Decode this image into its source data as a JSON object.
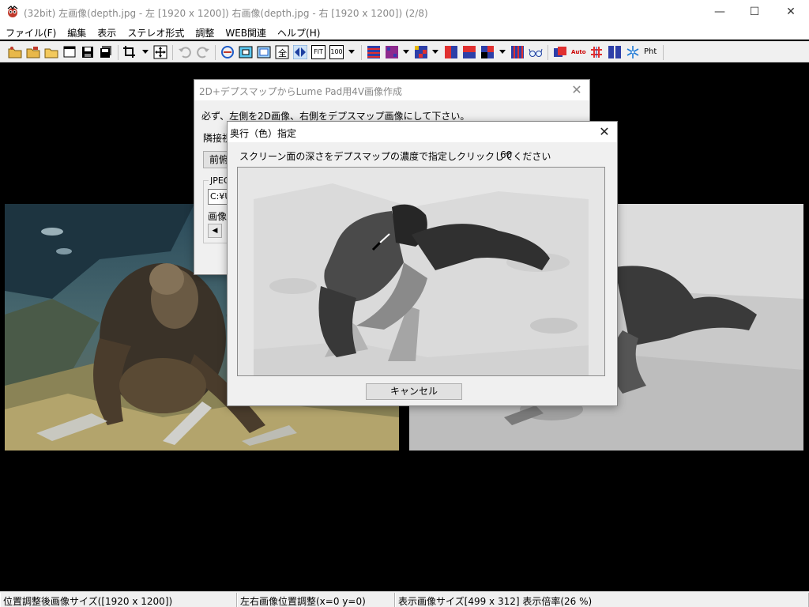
{
  "window": {
    "title": "(32bit) 左画像(depth.jpg - 左 [1920 x 1200]) 右画像(depth.jpg - 右 [1920 x 1200])  (2/8)",
    "minimize_label": "—",
    "maximize_label": "☐",
    "close_label": "✕"
  },
  "menu": [
    "ファイル(F)",
    "編集",
    "表示",
    "ステレオ形式",
    "調整",
    "WEB関連",
    "ヘルプ(H)"
  ],
  "toolbar": {
    "fit_label": "FIT",
    "zoom100_label": "100",
    "pht_label": "Pht",
    "auto_label": "Auto"
  },
  "back_dialog": {
    "title": "2D+デプスマップからLume Pad用4V画像作成",
    "close_label": "✕",
    "instruction": "必ず、左側を2D画像、右側をデプスマップ画像にして下さい。",
    "partial_label_1": "隣接視",
    "partial_button": "前俯",
    "group_label": "JPEG",
    "path_value": "C:¥U",
    "partial_label_2": "画像"
  },
  "front_dialog": {
    "title": "奥行（色）指定",
    "close_label": "✕",
    "prompt": "スクリーン面の深さをデプスマップの濃度で指定しクリックしてください",
    "depth_value": "60",
    "cancel_label": "キャンセル"
  },
  "statusbar": {
    "cell1": "位置調整後画像サイズ([1920 x 1200])",
    "cell2": "左右画像位置調整(x=0 y=0)",
    "cell3": "表示画像サイズ[499 x 312]  表示倍率(26 %)"
  }
}
